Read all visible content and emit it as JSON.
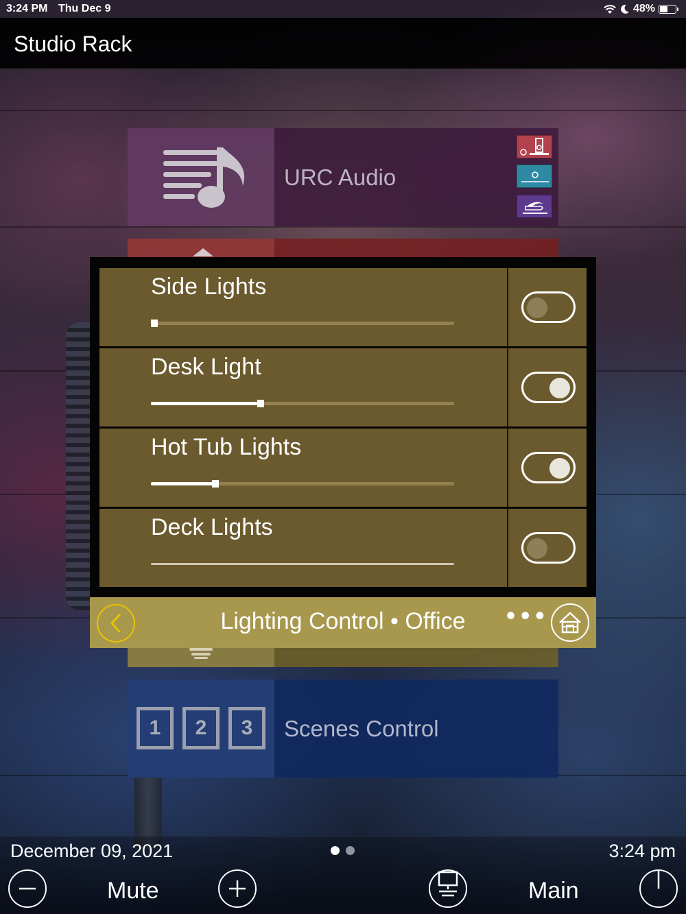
{
  "status_bar": {
    "time": "3:24 PM",
    "date": "Thu Dec 9",
    "battery": "48%",
    "icons": [
      "wifi-icon",
      "moon-icon",
      "battery-icon"
    ]
  },
  "header": {
    "title": "Studio Rack"
  },
  "activities": [
    {
      "label": "URC Audio",
      "icon": "music-notes-icon"
    },
    {
      "label": "",
      "icon": "up-arrow-icon"
    },
    {
      "label": "",
      "icon": "bulb-icon"
    },
    {
      "label": "Scenes Control",
      "icon": "scene-numbers-icon",
      "numbers": [
        "1",
        "2",
        "3"
      ]
    }
  ],
  "source_icons": [
    "ipod-dock-icon",
    "tv-source-icon",
    "bluray-disc-icon"
  ],
  "lighting_popup": {
    "title": "Lighting Control • Office",
    "loads": [
      {
        "name": "Side Lights",
        "level": 0.01,
        "on": false,
        "enabled": true
      },
      {
        "name": "Desk Light",
        "level": 0.36,
        "on": true,
        "enabled": true
      },
      {
        "name": "Hot Tub Lights",
        "level": 0.21,
        "on": true,
        "enabled": true
      },
      {
        "name": "Deck Lights",
        "level": 0.0,
        "on": false,
        "enabled": false
      }
    ],
    "more_label": "•••",
    "icons": {
      "back": "chevron-left-icon",
      "home": "home-icon"
    }
  },
  "bottom_bar": {
    "date": "December 09, 2021",
    "time": "3:24 pm",
    "mute_label": "Mute",
    "main_label": "Main",
    "pages": 2,
    "active_page": 1
  },
  "colors": {
    "row_bg": "#6b5a2d",
    "popup_bar": "#a8984e",
    "back_ring": "#e9c200",
    "audio_card": "#3c193c",
    "scenes_card": "#0f285f"
  }
}
